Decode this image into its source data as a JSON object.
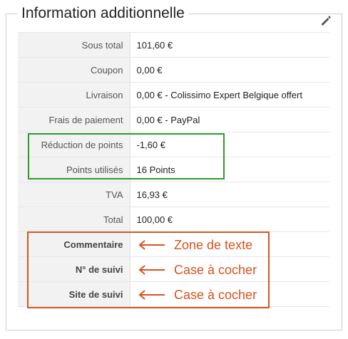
{
  "panel": {
    "title": "Information additionnelle",
    "edit_icon": "pencil-icon"
  },
  "rows": [
    {
      "label": "Sous total",
      "value": "101,60 €"
    },
    {
      "label": "Coupon",
      "value": "0,00 €"
    },
    {
      "label": "Livraison",
      "value": "0,00 € - Colissimo Expert Belgique offert"
    },
    {
      "label": "Frais de paiement",
      "value": "0,00 € - PayPal"
    },
    {
      "label": "Réduction de points",
      "value": "-1,60 €"
    },
    {
      "label": "Points utilisés",
      "value": "16 Points"
    },
    {
      "label": "TVA",
      "value": "16,93 €"
    },
    {
      "label": "Total",
      "value": "100,00 €"
    },
    {
      "label": "Commentaire",
      "value": ""
    },
    {
      "label": "N° de suivi",
      "value": ""
    },
    {
      "label": "Site de suivi",
      "value": ""
    }
  ],
  "annotations": {
    "commentaire": "Zone de texte",
    "suivi": "Case à cocher",
    "site_suivi": "Case à cocher",
    "green_color": "#2e9a2e",
    "orange_color": "#d9531e"
  }
}
